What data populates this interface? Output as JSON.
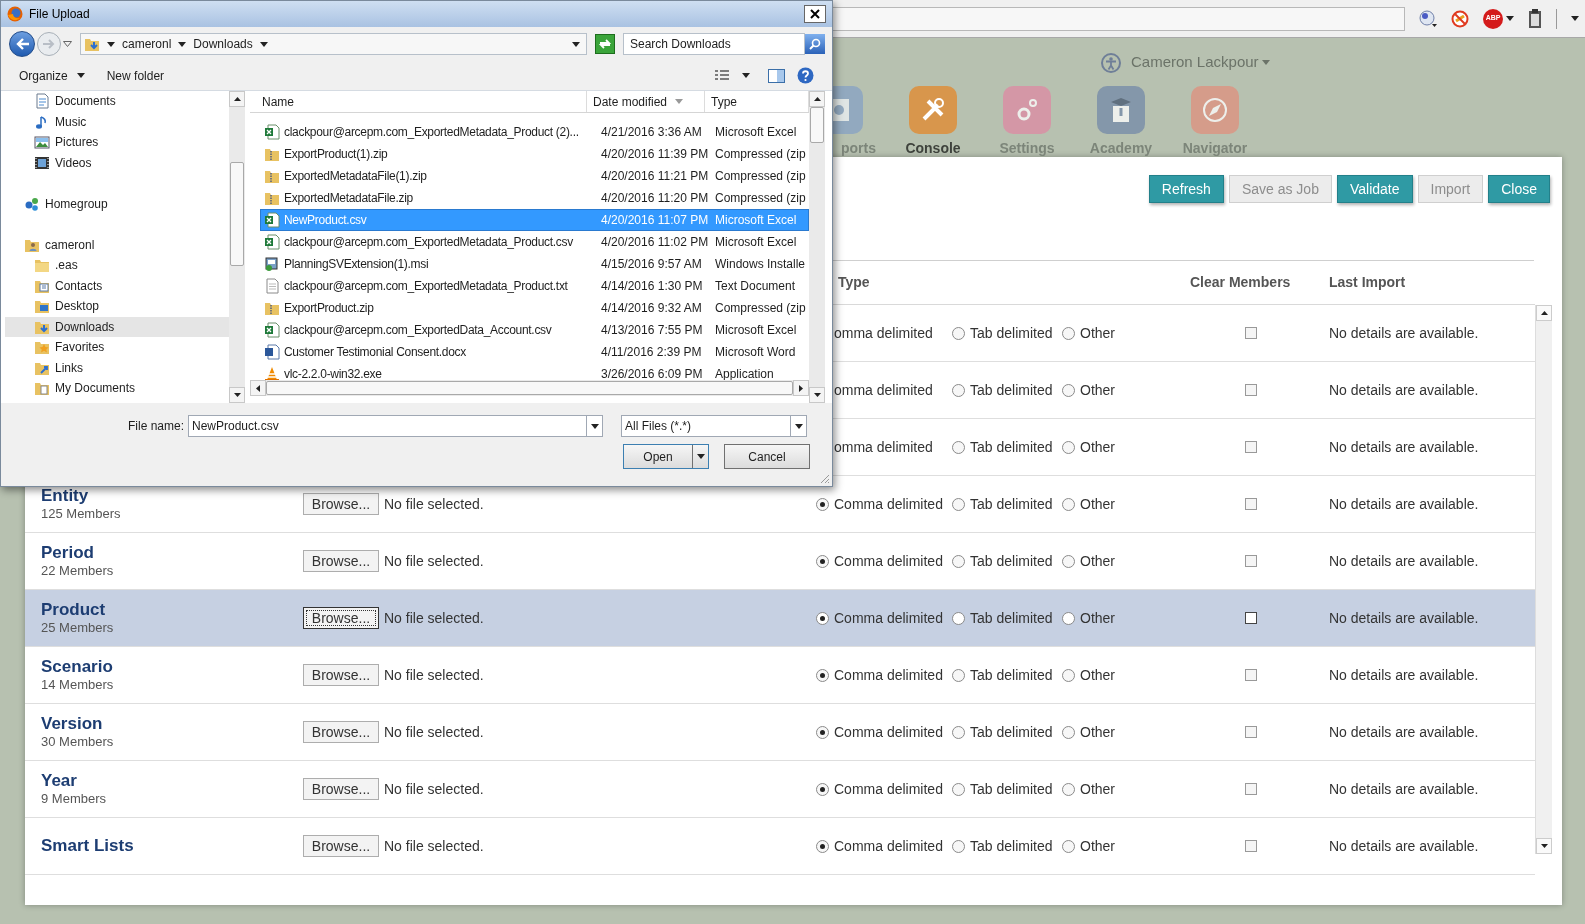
{
  "browser": {
    "abp_badge": "ABP"
  },
  "header": {
    "user": "Cameron Lackpour",
    "apps": [
      {
        "label": "ports",
        "kind": "chart",
        "selected": false
      },
      {
        "label": "Console",
        "kind": "tools",
        "selected": true
      },
      {
        "label": "Settings",
        "kind": "gears",
        "selected": false
      },
      {
        "label": "Academy",
        "kind": "graduate",
        "selected": false
      },
      {
        "label": "Navigator",
        "kind": "compass",
        "selected": false
      }
    ]
  },
  "panel": {
    "buttons": [
      {
        "label": "Refresh",
        "disabled": false
      },
      {
        "label": "Save as Job",
        "disabled": true
      },
      {
        "label": "Validate",
        "disabled": false
      },
      {
        "label": "Import",
        "disabled": true
      },
      {
        "label": "Close",
        "disabled": false
      }
    ],
    "columns": [
      "Type",
      "Clear Members",
      "Last Import"
    ],
    "rows": [
      {
        "selected": false,
        "options": [
          {
            "label": "omma delimited"
          },
          {
            "label": "Tab delimited",
            "selected": false
          },
          {
            "label": "Other",
            "selected": false
          }
        ],
        "clear": false,
        "last_import": "No details are available."
      },
      {
        "selected": false,
        "options": [
          {
            "label": "omma delimited"
          },
          {
            "label": "Tab delimited",
            "selected": false
          },
          {
            "label": "Other",
            "selected": false
          }
        ],
        "clear": false,
        "last_import": "No details are available."
      },
      {
        "selected": false,
        "options": [
          {
            "label": "omma delimited"
          },
          {
            "label": "Tab delimited",
            "selected": false
          },
          {
            "label": "Other",
            "selected": false
          }
        ],
        "clear": false,
        "last_import": "No details are available."
      },
      {
        "name": "Entity",
        "members": "125 Members",
        "browse": "Browse...",
        "file_status": "No file selected.",
        "selected": false,
        "options": [
          {
            "label": "Comma delimited",
            "selected": true
          },
          {
            "label": "Tab delimited",
            "selected": false
          },
          {
            "label": "Other",
            "selected": false
          }
        ],
        "clear": false,
        "last_import": "No details are available."
      },
      {
        "name": "Period",
        "members": "22 Members",
        "browse": "Browse...",
        "file_status": "No file selected.",
        "selected": false,
        "options": [
          {
            "label": "Comma delimited",
            "selected": true
          },
          {
            "label": "Tab delimited",
            "selected": false
          },
          {
            "label": "Other",
            "selected": false
          }
        ],
        "clear": false,
        "last_import": "No details are available."
      },
      {
        "name": "Product",
        "members": "25 Members",
        "browse": "Browse...",
        "file_status": "No file selected.",
        "selected": true,
        "options": [
          {
            "label": "Comma delimited",
            "selected": true
          },
          {
            "label": "Tab delimited",
            "selected": false
          },
          {
            "label": "Other",
            "selected": false
          }
        ],
        "clear": false,
        "last_import": "No details are available."
      },
      {
        "name": "Scenario",
        "members": "14 Members",
        "browse": "Browse...",
        "file_status": "No file selected.",
        "selected": false,
        "options": [
          {
            "label": "Comma delimited",
            "selected": true
          },
          {
            "label": "Tab delimited",
            "selected": false
          },
          {
            "label": "Other",
            "selected": false
          }
        ],
        "clear": false,
        "last_import": "No details are available."
      },
      {
        "name": "Version",
        "members": "30 Members",
        "browse": "Browse...",
        "file_status": "No file selected.",
        "selected": false,
        "options": [
          {
            "label": "Comma delimited",
            "selected": true
          },
          {
            "label": "Tab delimited",
            "selected": false
          },
          {
            "label": "Other",
            "selected": false
          }
        ],
        "clear": false,
        "last_import": "No details are available."
      },
      {
        "name": "Year",
        "members": "9 Members",
        "browse": "Browse...",
        "file_status": "No file selected.",
        "selected": false,
        "options": [
          {
            "label": "Comma delimited",
            "selected": true
          },
          {
            "label": "Tab delimited",
            "selected": false
          },
          {
            "label": "Other",
            "selected": false
          }
        ],
        "clear": false,
        "last_import": "No details are available."
      },
      {
        "name": "Smart Lists",
        "browse": "Browse...",
        "file_status": "No file selected.",
        "selected": false,
        "options": [
          {
            "label": "Comma delimited",
            "selected": true
          },
          {
            "label": "Tab delimited",
            "selected": false
          },
          {
            "label": "Other",
            "selected": false
          }
        ],
        "clear": false,
        "last_import": "No details are available."
      }
    ]
  },
  "dialog": {
    "title": "File Upload",
    "breadcrumb": [
      "cameronl",
      "Downloads"
    ],
    "search": {
      "placeholder": "Search Downloads"
    },
    "toolbar": [
      {
        "label": "Organize",
        "kind": "menu"
      },
      {
        "label": "New folder",
        "kind": "plain"
      }
    ],
    "nav": [
      {
        "children": [
          {
            "label": "Documents",
            "kind": "documents",
            "selected": false
          },
          {
            "label": "Music",
            "kind": "music",
            "selected": false
          },
          {
            "label": "Pictures",
            "kind": "pictures",
            "selected": false
          },
          {
            "label": "Videos",
            "kind": "videos",
            "selected": false
          }
        ]
      },
      {
        "label": "Homegroup",
        "kind": "homegroup",
        "selected": false
      },
      {
        "label": "cameronl",
        "kind": "userfolder",
        "selected": false,
        "children": [
          {
            "label": ".eas",
            "kind": "folder",
            "selected": false
          },
          {
            "label": "Contacts",
            "kind": "contacts",
            "selected": false
          },
          {
            "label": "Desktop",
            "kind": "desktop",
            "selected": false
          },
          {
            "label": "Downloads",
            "kind": "downloads",
            "selected": true
          },
          {
            "label": "Favorites",
            "kind": "favorites",
            "selected": false
          },
          {
            "label": "Links",
            "kind": "links",
            "selected": false
          },
          {
            "label": "My Documents",
            "kind": "mydocuments",
            "selected": false
          }
        ]
      }
    ],
    "columns": [
      "Name",
      "Date modified",
      "Type"
    ],
    "files": [
      {
        "name": "clackpour@arcepm.com_ExportedMetadata_Product (2)...",
        "date": "4/21/2016 3:36 AM",
        "type": "Microsoft Excel",
        "kind": "excel",
        "selected": false
      },
      {
        "name": "ExportProduct(1).zip",
        "date": "4/20/2016 11:39 PM",
        "type": "Compressed (zip",
        "kind": "zip",
        "selected": false
      },
      {
        "name": "ExportedMetadataFile(1).zip",
        "date": "4/20/2016 11:21 PM",
        "type": "Compressed (zip",
        "kind": "zip",
        "selected": false
      },
      {
        "name": "ExportedMetadataFile.zip",
        "date": "4/20/2016 11:20 PM",
        "type": "Compressed (zip",
        "kind": "zip",
        "selected": false
      },
      {
        "name": "NewProduct.csv",
        "date": "4/20/2016 11:07 PM",
        "type": "Microsoft Excel",
        "kind": "excel",
        "selected": true
      },
      {
        "name": "clackpour@arcepm.com_ExportedMetadata_Product.csv",
        "date": "4/20/2016 11:02 PM",
        "type": "Microsoft Excel",
        "kind": "excel",
        "selected": false
      },
      {
        "name": "PlanningSVExtension(1).msi",
        "date": "4/15/2016 9:57 AM",
        "type": "Windows Installe",
        "kind": "installer",
        "selected": false
      },
      {
        "name": "clackpour@arcepm.com_ExportedMetadata_Product.txt",
        "date": "4/14/2016 1:30 PM",
        "type": "Text Document",
        "kind": "text",
        "selected": false
      },
      {
        "name": "ExportProduct.zip",
        "date": "4/14/2016 9:32 AM",
        "type": "Compressed (zip",
        "kind": "zip",
        "selected": false
      },
      {
        "name": "clackpour@arcepm.com_ExportedData_Account.csv",
        "date": "4/13/2016 7:55 PM",
        "type": "Microsoft Excel",
        "kind": "excel",
        "selected": false
      },
      {
        "name": "Customer Testimonial Consent.docx",
        "date": "4/11/2016 2:39 PM",
        "type": "Microsoft Word",
        "kind": "word",
        "selected": false
      },
      {
        "name": "vlc-2.2.0-win32.exe",
        "date": "3/26/2016 6:09 PM",
        "type": "Application",
        "kind": "exe",
        "selected": false
      }
    ],
    "file_name": {
      "label": "File name:",
      "value": "NewProduct.csv"
    },
    "filter": "All Files (*.*)",
    "buttons": [
      {
        "label": "Open",
        "kind": "split"
      },
      {
        "label": "Cancel",
        "kind": "plain"
      }
    ]
  }
}
